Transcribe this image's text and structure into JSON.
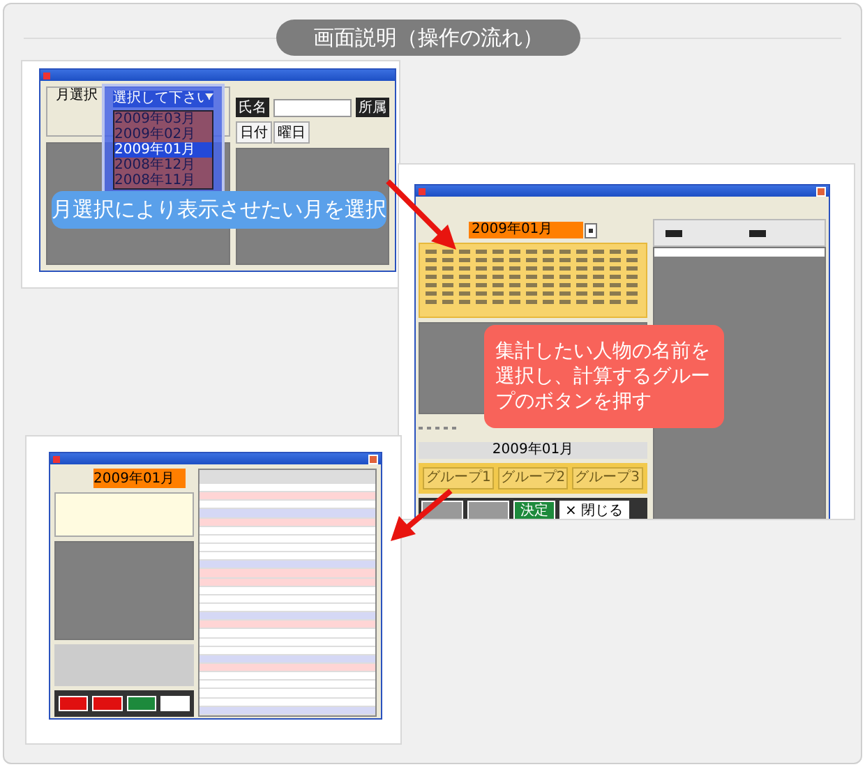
{
  "title": "画面説明（操作の流れ）",
  "step1": {
    "month_group": "月選択",
    "placeholder": "選択して下さい",
    "months": [
      {
        "label": "2009年03月",
        "selected": false
      },
      {
        "label": "2009年02月",
        "selected": false
      },
      {
        "label": "2009年01月",
        "selected": true
      },
      {
        "label": "2008年12月",
        "selected": false
      },
      {
        "label": "2008年11月",
        "selected": false
      }
    ],
    "name_label": "氏名",
    "dept_label": "所属",
    "columns": [
      "日付",
      "曜日"
    ],
    "callout": "月選択により表示させたい月を選択"
  },
  "step2": {
    "month_value": "2009年01月",
    "period": "2009年01月",
    "group_buttons": [
      "グループ1",
      "グループ2",
      "グループ3"
    ],
    "buttons": [
      {
        "kind": "plain"
      },
      {
        "kind": "plain"
      },
      {
        "kind": "go",
        "label": "決定"
      },
      {
        "kind": "close",
        "label": "× 閉じる"
      }
    ],
    "callout": "集計したい人物の名前を選択し、計算するグループのボタンを押す"
  },
  "step3": {
    "month_value": "2009年01月",
    "buttons": [
      {
        "kind": "red"
      },
      {
        "kind": "red"
      },
      {
        "kind": "go"
      },
      {
        "kind": "close"
      }
    ]
  }
}
